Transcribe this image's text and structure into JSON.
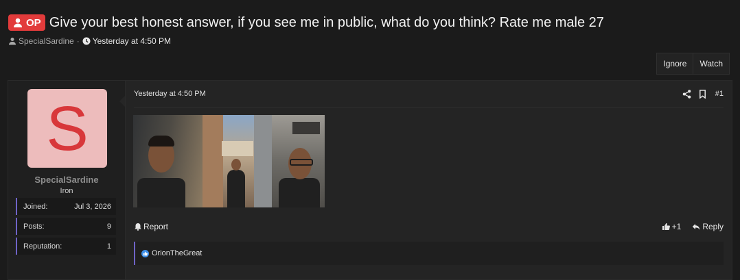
{
  "thread": {
    "badge": "OP",
    "title": "Give your best honest answer, if you see me in public, what do you think? Rate me male 27",
    "author": "SpecialSardine",
    "separator": "·",
    "time": "Yesterday at 4:50 PM"
  },
  "actions": {
    "ignore": "Ignore",
    "watch": "Watch"
  },
  "user": {
    "avatar_letter": "S",
    "name": "SpecialSardine",
    "rank": "Iron",
    "stats": [
      {
        "label": "Joined:",
        "value": "Jul 3, 2026"
      },
      {
        "label": "Posts:",
        "value": "9"
      },
      {
        "label": "Reputation:",
        "value": "1"
      }
    ]
  },
  "post": {
    "date": "Yesterday at 4:50 PM",
    "number": "#1",
    "report": "Report",
    "like_count": "+1",
    "reply": "Reply",
    "reacted_by": "OrionTheGreat"
  },
  "colors": {
    "op_badge": "#e23b3b",
    "accent": "#6f64c7",
    "avatar_bg": "#edbcbc",
    "avatar_letter": "#d8373a",
    "like": "#3d8fe8"
  }
}
